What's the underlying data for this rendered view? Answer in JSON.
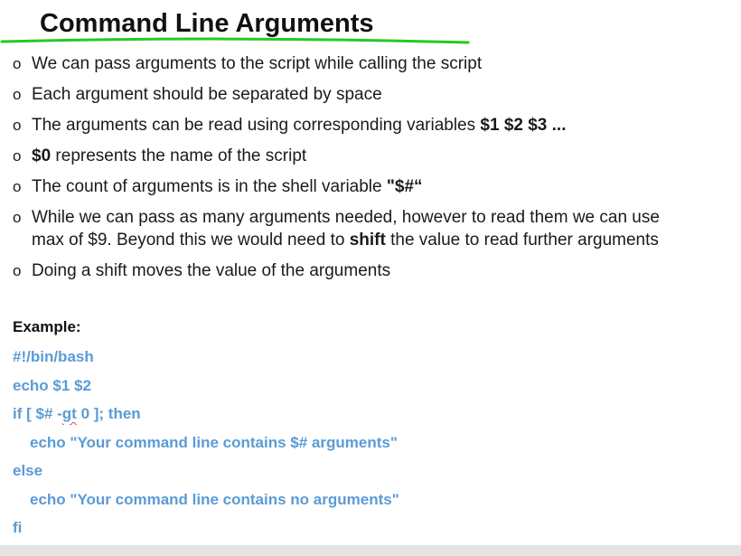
{
  "title": "Command Line Arguments",
  "bullet_marker": "o",
  "bullets": [
    {
      "text": "We can pass arguments to the script while calling the script"
    },
    {
      "text": "Each argument should be separated by space"
    },
    {
      "pre": "The arguments can be read using corresponding variables ",
      "bold": "$1 $2 $3 ..."
    },
    {
      "bold": "$0",
      "post": " represents the name of the script"
    },
    {
      "pre": "The count of arguments is in the shell variable ",
      "bold": "\"$#“"
    },
    {
      "line1": "While we can pass as many arguments needed, however to read them we can use",
      "line2_pre": "max of $9. Beyond this we would need to ",
      "line2_bold": "shift",
      "line2_post": " the value to read further arguments"
    },
    {
      "text": "Doing a shift moves the value of the arguments"
    }
  ],
  "example_label": "Example:",
  "code": {
    "line1": "#!/bin/bash",
    "line2": "echo $1 $2",
    "line3_pre": "if [ $# -",
    "line3_squiggle": "gt",
    "line3_post": " 0 ]; then",
    "line4": "echo \"Your command line contains $# arguments\"",
    "line5": "else",
    "line6": "echo \"Your command line contains no arguments\"",
    "line7": "fi"
  },
  "colors": {
    "code": "#5b9bd5",
    "underline": "#22cc22",
    "text": "#1a1a1a"
  }
}
